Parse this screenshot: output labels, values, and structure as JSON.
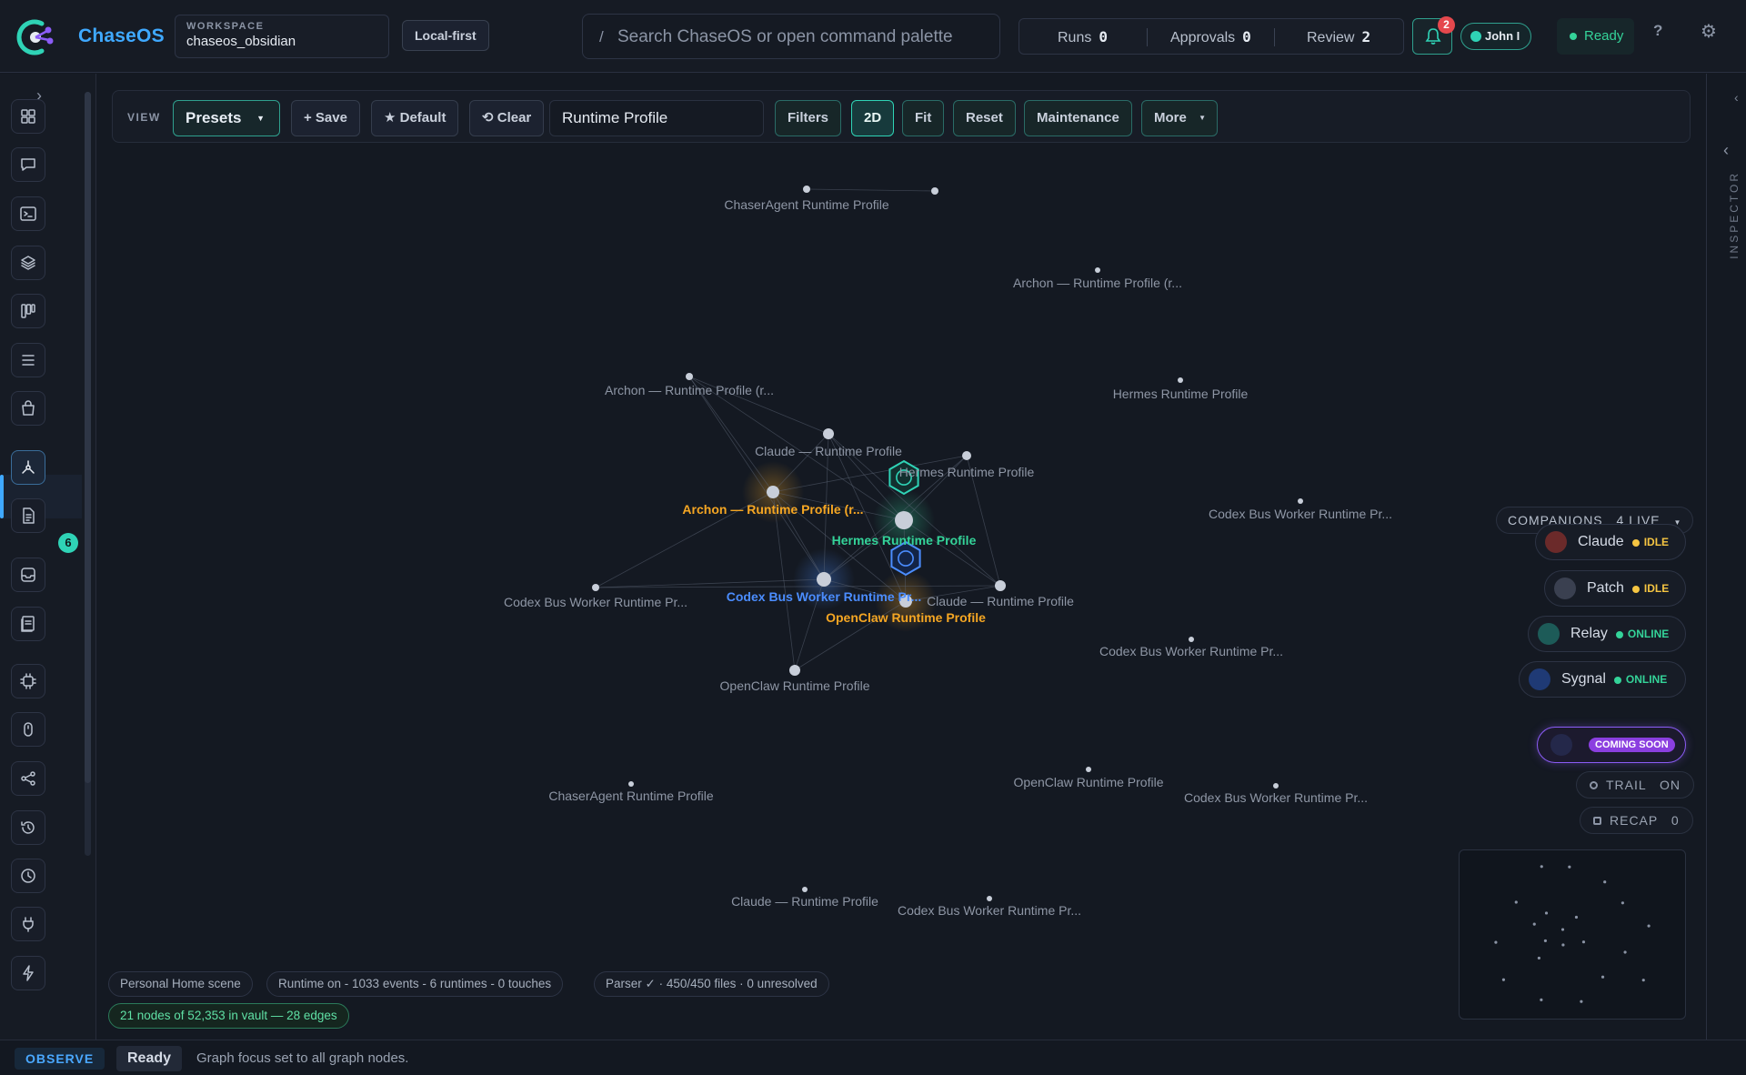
{
  "header": {
    "brand": "ChaseOS",
    "workspace_label": "WORKSPACE",
    "workspace_name": "chaseos_obsidian",
    "mode": "Local-first",
    "search_slash": "/",
    "search_placeholder": "Search ChaseOS or open command palette",
    "counters": [
      {
        "label": "Runs",
        "value": "0"
      },
      {
        "label": "Approvals",
        "value": "0"
      },
      {
        "label": "Review",
        "value": "2"
      }
    ],
    "notifications_count": "2",
    "user": "John I",
    "status": "Ready",
    "help": "?",
    "settings": "⚙"
  },
  "rail": {
    "expand": "›",
    "items": [
      "grid-icon",
      "chat-icon",
      "terminal-icon",
      "layers-icon",
      "kanban-icon",
      "list-icon",
      "bag-icon",
      "graph-icon",
      "document-icon",
      "inbox-icon",
      "notes-icon",
      "chip-icon",
      "mouse-icon",
      "share-icon",
      "history-icon",
      "clock-icon",
      "plug-icon",
      "bolt-icon"
    ],
    "active_item": "graph-icon",
    "documents_badge": "6"
  },
  "toolbar": {
    "view_label": "VIEW",
    "presets": "Presets",
    "save": "+ Save",
    "default": "★ Default",
    "clear": "⟲ Clear",
    "query": "Runtime Profile",
    "filters": "Filters",
    "mode_2d": "2D",
    "fit": "Fit",
    "reset": "Reset",
    "maintenance": "Maintenance",
    "more": "More"
  },
  "graph": {
    "labels": {
      "chaser_top": "ChaserAgent Runtime Profile",
      "archon_top": "Archon — Runtime Profile (r...",
      "archon_left": "Archon — Runtime Profile (r...",
      "hermes_right": "Hermes Runtime Profile",
      "claude_mid": "Claude — Runtime Profile",
      "hermes_near": "Hermes Runtime Profile",
      "archon_hl": "Archon — Runtime Profile (r...",
      "codex_right": "Codex Bus Worker Runtime Pr...",
      "hermes_hl": "Hermes Runtime Profile",
      "codex_left": "Codex Bus Worker Runtime Pr...",
      "codex_hl": "Codex Bus Worker Runtime Pr...",
      "claude_right": "Claude — Runtime Profile",
      "openclaw_hl": "OpenClaw Runtime Profile",
      "codex_mid_right": "Codex Bus Worker Runtime Pr...",
      "openclaw_below": "OpenClaw Runtime Profile",
      "chaser_low": "ChaserAgent Runtime Profile",
      "openclaw_low": "OpenClaw Runtime Profile",
      "codex_low_right": "Codex Bus Worker Runtime Pr...",
      "claude_bottom": "Claude — Runtime Profile",
      "codex_bottom": "Codex Bus Worker Runtime Pr..."
    },
    "colors": {
      "archon": "#f5a623",
      "hermes": "#34d399",
      "codex": "#4b8dff",
      "openclaw": "#f5a623"
    }
  },
  "companions": {
    "header": "COMPANIONS",
    "live": "4 LIVE",
    "items": [
      {
        "name": "Claude",
        "status": "IDLE",
        "status_color": "#f5c542"
      },
      {
        "name": "Patch",
        "status": "IDLE",
        "status_color": "#f5c542"
      },
      {
        "name": "Relay",
        "status": "ONLINE",
        "status_color": "#34d399"
      },
      {
        "name": "Sygnal",
        "status": "ONLINE",
        "status_color": "#34d399"
      }
    ],
    "coming_soon": "COMING SOON",
    "trail_label": "TRAIL",
    "trail_value": "ON",
    "recap_label": "RECAP",
    "recap_value": "0"
  },
  "chips": {
    "scene": "Personal Home scene",
    "runtime": "Runtime on - 1033 events - 6 runtimes - 0 touches",
    "parser": "Parser ✓ · 450/450 files · 0 unresolved",
    "nodes": "21 nodes of 52,353 in vault — 28 edges"
  },
  "inspector": {
    "collapse": "‹",
    "back": "‹",
    "label": "INSPECTOR"
  },
  "statusbar": {
    "mode": "OBSERVE",
    "state": "Ready",
    "message": "Graph focus set to all graph nodes."
  }
}
